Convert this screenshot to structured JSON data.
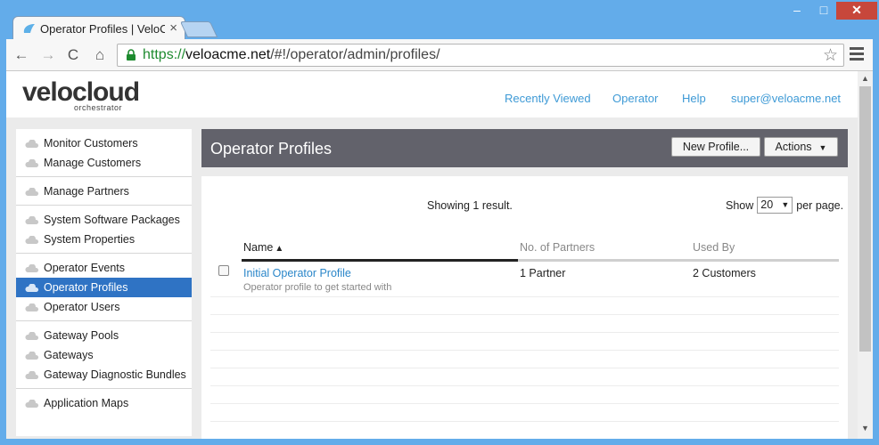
{
  "browser": {
    "tab_title": "Operator Profiles | VeloCloud",
    "tab_close": "×",
    "window_controls": {
      "minimize": "–",
      "maximize": "□",
      "close": "✕"
    },
    "url_scheme": "https://",
    "url_host": "veloacme.net",
    "url_path": "/#!/operator/admin/profiles/",
    "nav_icons": {
      "back": "←",
      "forward": "→",
      "reload": "C",
      "home": "⌂",
      "star": "☆"
    }
  },
  "app": {
    "logo_word": "velocloud",
    "logo_sub": "orchestrator",
    "topnav": [
      "Recently Viewed",
      "Operator",
      "Help",
      "super@veloacme.net"
    ]
  },
  "sidebar": {
    "groups": [
      [
        "Monitor Customers",
        "Manage Customers"
      ],
      [
        "Manage Partners"
      ],
      [
        "System Software Packages",
        "System Properties"
      ],
      [
        "Operator Events",
        "Operator Profiles",
        "Operator Users"
      ],
      [
        "Gateway Pools",
        "Gateways",
        "Gateway Diagnostic Bundles"
      ],
      [
        "Application Maps"
      ]
    ],
    "active": "Operator Profiles"
  },
  "main": {
    "title": "Operator Profiles",
    "new_profile_label": "New Profile...",
    "actions_label": "Actions",
    "actions_caret": "▼",
    "showing": "Showing 1 result.",
    "show_label": "Show",
    "per_page_value": "20",
    "per_page_caret": "▼",
    "per_page_label": "per page.",
    "columns": {
      "name": "Name",
      "name_sort": "▲",
      "partners": "No. of Partners",
      "used_by": "Used By"
    },
    "rows": [
      {
        "name": "Initial Operator Profile",
        "description": "Operator profile to get started with",
        "partners": "1 Partner",
        "used_by": "2 Customers"
      }
    ]
  },
  "scrollbar": {
    "up": "▲",
    "down": "▼"
  }
}
